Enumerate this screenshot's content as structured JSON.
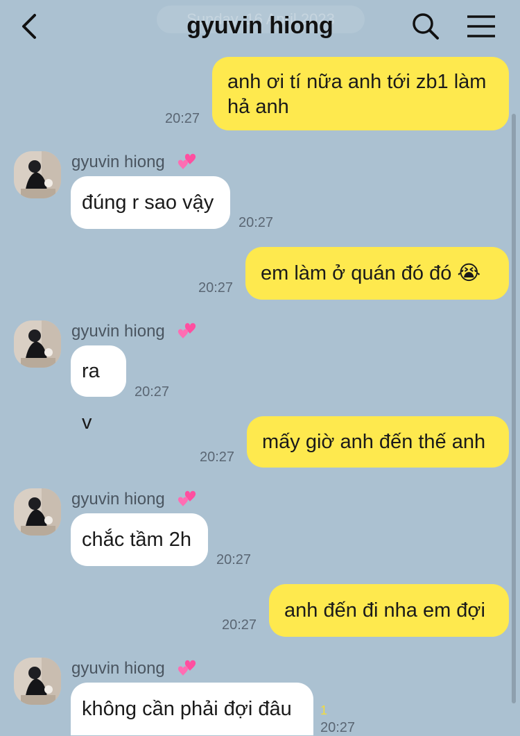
{
  "header": {
    "title": "gyuvin hiong",
    "date_hint": "Sunday, 16 April 2023"
  },
  "messages": [
    {
      "from": "me",
      "lines": [
        "anh ơi tí nữa anh tới zb1 làm",
        "hả anh"
      ],
      "time": "20:27"
    },
    {
      "from": "them",
      "sender": "gyuvin hiong",
      "text": "đúng r sao vậy",
      "time": "20:27"
    },
    {
      "from": "me",
      "text": "em làm ở quán đó đó 😭",
      "time": "20:27"
    },
    {
      "from": "them",
      "sender": "gyuvin hiong",
      "text": "ra v",
      "time": "20:27"
    },
    {
      "from": "me",
      "text": "mấy giờ anh đến thế anh",
      "time": "20:27"
    },
    {
      "from": "them",
      "sender": "gyuvin hiong",
      "text": "chắc tầm 2h",
      "time": "20:27"
    },
    {
      "from": "me",
      "text": "anh đến đi nha em đợi",
      "time": "20:27"
    },
    {
      "from": "them",
      "sender": "gyuvin hiong",
      "text": "không cần phải đợi đâu",
      "time": "20:27",
      "unread_count": "1"
    }
  ],
  "icons": {
    "back": "chevron-left-icon",
    "search": "search-icon",
    "menu": "hamburger-menu-icon",
    "heart": "two-hearts-emoji"
  },
  "colors": {
    "background": "#abc1d1",
    "my_bubble": "#fee94e",
    "their_bubble": "#ffffff",
    "heart": "#ff4fa0"
  }
}
